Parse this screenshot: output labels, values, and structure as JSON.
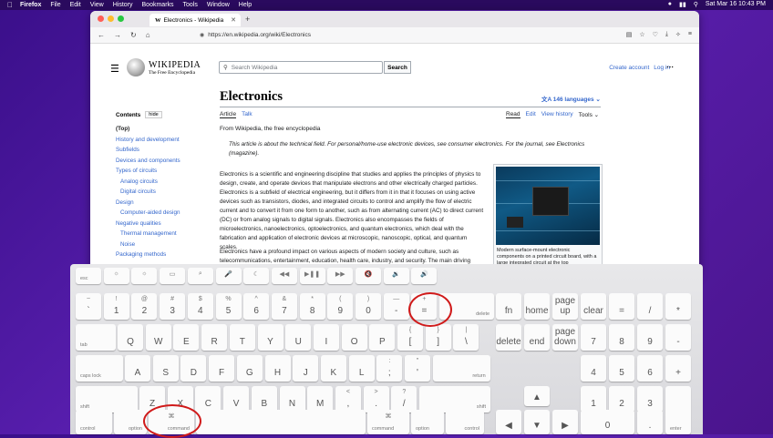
{
  "menubar": {
    "app": "Firefox",
    "items": [
      "File",
      "Edit",
      "View",
      "History",
      "Bookmarks",
      "Tools",
      "Window",
      "Help"
    ],
    "datetime": "Sat Mar 16 10:43 PM"
  },
  "browser": {
    "tab_title": "Electronics - Wikipedia",
    "url": "https://en.wikipedia.org/wiki/Electronics"
  },
  "wiki": {
    "logo_wordmark": "Wikipedia",
    "logo_tagline": "The Free Encyclopedia",
    "search_placeholder": "Search Wikipedia",
    "search_button": "Search",
    "create_account": "Create account",
    "login": "Log in",
    "title": "Electronics",
    "languages": "146 languages",
    "tabs_left": [
      "Article",
      "Talk"
    ],
    "tabs_right": [
      "Read",
      "Edit",
      "View history",
      "Tools"
    ],
    "from": "From Wikipedia, the free encyclopedia",
    "hatnote": "This article is about the technical field. For personal/home-use electronic devices, see consumer electronics. For the journal, see Electronics (magazine).",
    "para1": "Electronics is a scientific and engineering discipline that studies and applies the principles of physics to design, create, and operate devices that manipulate electrons and other electrically charged particles. Electronics is a subfield of electrical engineering, but it differs from it in that it focuses on using active devices such as transistors, diodes, and integrated circuits to control and amplify the flow of electric current and to convert it from one form to another, such as from alternating current (AC) to direct current (DC) or from analog signals to digital signals. Electronics also encompasses the fields of microelectronics, nanoelectronics, optoelectronics, and quantum electronics, which deal with the fabrication and application of electronic devices at microscopic, nanoscopic, optical, and quantum scales.",
    "para2": "Electronics have a profound impact on various aspects of modern society and culture, such as telecommunications, entertainment, education, health care, industry, and security. The main driving force behind the advancement of electronics is the semiconductor industry, which produces the basic materials",
    "caption": "Modern surface-mount electronic components on a printed circuit board, with a large integrated circuit at the top",
    "toc_title": "Contents",
    "toc_hide": "hide",
    "toc": [
      {
        "label": "(Top)",
        "level": 0
      },
      {
        "label": "History and development",
        "level": 0
      },
      {
        "label": "Subfields",
        "level": 0
      },
      {
        "label": "Devices and components",
        "level": 0
      },
      {
        "label": "Types of circuits",
        "level": 0
      },
      {
        "label": "Analog circuits",
        "level": 1
      },
      {
        "label": "Digital circuits",
        "level": 1
      },
      {
        "label": "Design",
        "level": 0
      },
      {
        "label": "Computer-aided design",
        "level": 1
      },
      {
        "label": "Negative qualities",
        "level": 0
      },
      {
        "label": "Thermal management",
        "level": 1
      },
      {
        "label": "Noise",
        "level": 1
      },
      {
        "label": "Packaging methods",
        "level": 0
      }
    ]
  },
  "keyboard": {
    "fn_row": [
      "esc",
      "☼",
      "☼",
      "▭",
      "⌕",
      "🎤",
      "☾",
      "◀◀",
      "▶❚❚",
      "▶▶",
      "🔇",
      "🔉",
      "🔊"
    ],
    "num_row": [
      [
        "~",
        "`"
      ],
      [
        "!",
        "1"
      ],
      [
        "@",
        "2"
      ],
      [
        "#",
        "3"
      ],
      [
        "$",
        "4"
      ],
      [
        "%",
        "5"
      ],
      [
        "^",
        "6"
      ],
      [
        "&",
        "7"
      ],
      [
        "*",
        "8"
      ],
      [
        "(",
        "9"
      ],
      [
        ")",
        "0"
      ],
      [
        "—",
        "-"
      ],
      [
        "+",
        "="
      ]
    ],
    "delete": "delete",
    "qwerty": [
      "Q",
      "W",
      "E",
      "R",
      "T",
      "Y",
      "U",
      "I",
      "O",
      "P"
    ],
    "brackets": [
      [
        "{",
        "["
      ],
      [
        "}",
        "]"
      ],
      [
        "|",
        "\\"
      ]
    ],
    "tab": "tab",
    "asdf": [
      "A",
      "S",
      "D",
      "F",
      "G",
      "H",
      "J",
      "K",
      "L"
    ],
    "semi": [
      [
        ":",
        ";"
      ],
      [
        "\"",
        "'"
      ]
    ],
    "caps": "caps lock",
    "return": "return",
    "zxcv": [
      "Z",
      "X",
      "C",
      "V",
      "B",
      "N",
      "M"
    ],
    "punct": [
      [
        "<",
        ","
      ],
      [
        ">",
        "."
      ],
      [
        "?",
        "/"
      ]
    ],
    "shift": "shift",
    "control": "control",
    "option": "option",
    "command": "command",
    "cmd_symbol": "⌘",
    "nav": [
      "fn",
      "home",
      "page up",
      "clear",
      "=",
      "/",
      "*",
      "delete",
      "end",
      "page down",
      "7",
      "8",
      "9",
      "4",
      "5",
      "6",
      "1",
      "2",
      "3",
      "0",
      ".",
      "enter"
    ],
    "arrows": [
      "▲",
      "◀",
      "▼",
      "▶"
    ]
  }
}
